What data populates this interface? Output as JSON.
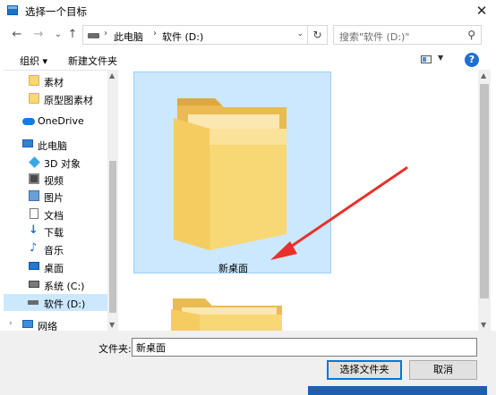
{
  "window": {
    "title": "选择一个目标",
    "close_glyph": "✕"
  },
  "address_bar": {
    "back_glyph": "←",
    "forward_glyph": "→",
    "recent_glyph": "⌄",
    "up_glyph": "↑",
    "crumbs": [
      "此电脑",
      "软件 (D:)"
    ],
    "crumb_sep": "›",
    "dropdown_glyph": "⌄",
    "refresh_glyph": "↻",
    "search_placeholder": "搜索\"软件 (D:)\"",
    "search_glyph": "⚲"
  },
  "toolbar": {
    "organize_label": "组织 ▾",
    "new_folder_label": "新建文件夹",
    "view_dd_glyph": "▼",
    "help_label": "?"
  },
  "nav": {
    "items": [
      {
        "label": "素材",
        "icon": "folder-icon"
      },
      {
        "label": "原型图素材",
        "icon": "folder-icon"
      },
      {
        "label": "OneDrive",
        "icon": "cloud-icon"
      },
      {
        "label": "此电脑",
        "icon": "computer-icon"
      },
      {
        "label": "3D 对象",
        "icon": "cube-icon"
      },
      {
        "label": "视频",
        "icon": "video-icon"
      },
      {
        "label": "图片",
        "icon": "picture-icon"
      },
      {
        "label": "文档",
        "icon": "document-icon"
      },
      {
        "label": "下载",
        "icon": "download-icon"
      },
      {
        "label": "音乐",
        "icon": "music-icon"
      },
      {
        "label": "桌面",
        "icon": "desktop-icon"
      },
      {
        "label": "系统 (C:)",
        "icon": "drive-icon"
      },
      {
        "label": "软件 (D:)",
        "icon": "drive-icon",
        "selected": true
      },
      {
        "label": "网络",
        "icon": "network-icon"
      }
    ],
    "expander_glyph": "›",
    "down_glyph": "↓",
    "music_glyph": "♪"
  },
  "content": {
    "selected_folder_label": "新桌面"
  },
  "footer": {
    "filename_label": "文件夹:",
    "filename_value": "新桌面",
    "select_button": "选择文件夹",
    "cancel_button": "取消"
  },
  "scroll_glyphs": {
    "up": "▲",
    "down": "▼"
  },
  "colors": {
    "selection": "#cce8ff",
    "accent": "#0078d7",
    "folder": "#f8d775",
    "arrow": "#e8312a"
  }
}
